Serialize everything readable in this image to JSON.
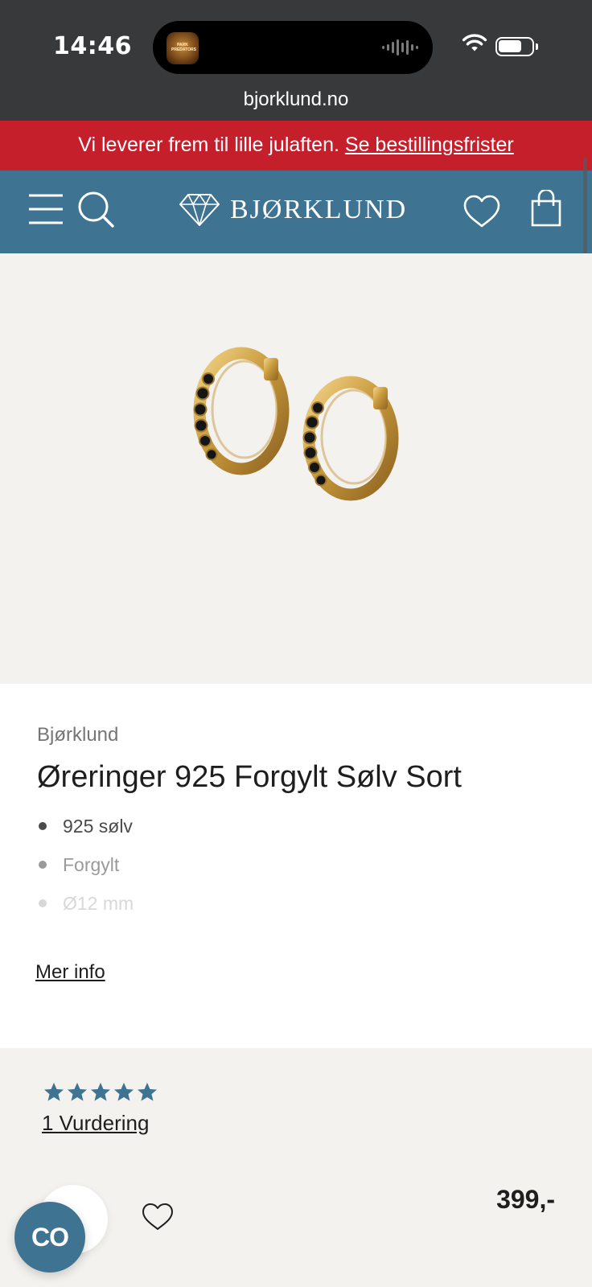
{
  "status_bar": {
    "time": "14:46",
    "live_activity_app_text": "PARK PREDATORS",
    "url": "bjorklund.no"
  },
  "promo": {
    "text": "Vi leverer frem til lille julaften.",
    "link": "Se bestillingsfrister"
  },
  "header": {
    "logo_text": "BJØRKLUND",
    "icons": [
      "menu-icon",
      "search-icon",
      "diamond-logo-icon",
      "heart-icon",
      "shopping-bag-icon"
    ]
  },
  "product": {
    "image_alt": "Gold hoop earrings with black stones",
    "brand": "Bjørklund",
    "title": "Øreringer 925 Forgylt Sølv Sort",
    "features": [
      "925 sølv",
      "Forgylt",
      "Ø12 mm"
    ],
    "more_info": "Mer info"
  },
  "rating": {
    "stars": 5,
    "reviews": "1 Vurdering"
  },
  "purchase": {
    "price": "399,-",
    "chat_badge": "CO"
  },
  "colors": {
    "status_bar": "#38393a",
    "promo": "#c61f2c",
    "header": "#3e7391",
    "page_bg": "#f4f2ee",
    "text": "#1e1e1e"
  }
}
